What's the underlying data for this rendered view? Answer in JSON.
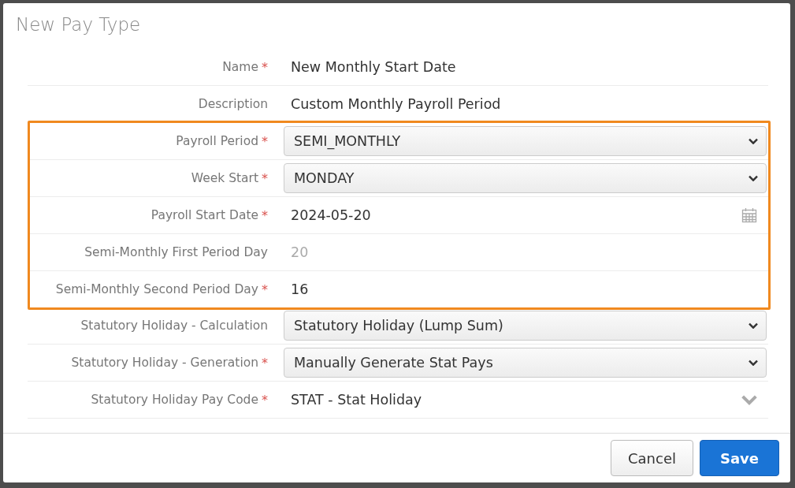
{
  "dialog": {
    "title": "New Pay Type"
  },
  "groups": [
    {
      "highlighted": false,
      "fields": [
        {
          "label": "Name",
          "required_mark": "*",
          "kind": "text",
          "value": "New Monthly Start Date"
        },
        {
          "label": "Description",
          "kind": "text",
          "value": "Custom Monthly Payroll Period"
        }
      ]
    },
    {
      "highlighted": true,
      "fields": [
        {
          "label": "Payroll Period",
          "required_mark": "*",
          "kind": "select",
          "value": "SEMI_MONTHLY"
        },
        {
          "label": "Week Start",
          "required_mark": "*",
          "kind": "select",
          "value": "MONDAY"
        },
        {
          "label": "Payroll Start Date",
          "required_mark": "*",
          "kind": "date",
          "value": "2024-05-20"
        },
        {
          "label": "Semi-Monthly First Period Day",
          "kind": "readonly",
          "value": "20"
        },
        {
          "label": "Semi-Monthly Second Period Day",
          "required_mark": "*",
          "kind": "text",
          "value": "16"
        }
      ]
    },
    {
      "highlighted": false,
      "fields": [
        {
          "label": "Statutory Holiday - Calculation",
          "kind": "select",
          "value": "Statutory Holiday (Lump Sum)"
        },
        {
          "label": "Statutory Holiday - Generation",
          "required_mark": "*",
          "kind": "select",
          "value": "Manually Generate Stat Pays"
        },
        {
          "label": "Statutory Holiday Pay Code",
          "required_mark": "*",
          "kind": "combo",
          "value": "STAT - Stat Holiday"
        }
      ]
    }
  ],
  "buttons": [
    {
      "label": "Cancel",
      "kind": "secondary"
    },
    {
      "label": "Save",
      "kind": "primary"
    }
  ]
}
